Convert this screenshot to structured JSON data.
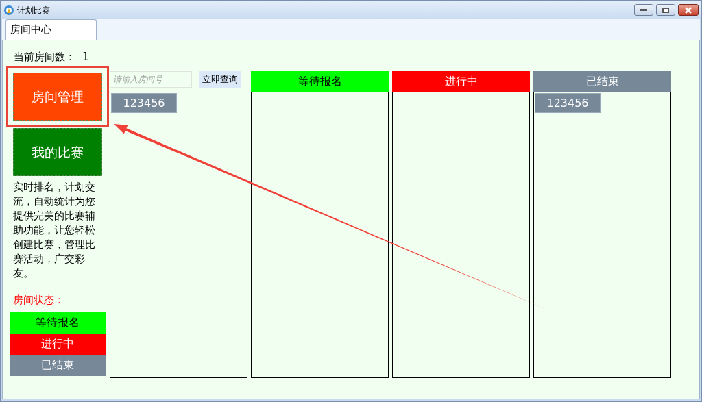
{
  "window": {
    "title": "计划比赛"
  },
  "tabs": [
    {
      "label": "房间中心",
      "selected": true
    }
  ],
  "room_count": {
    "label": "当前房间数：",
    "value": "1"
  },
  "nav_buttons": [
    {
      "label": "房间管理",
      "color": "#ff4500",
      "highlighted": true
    },
    {
      "label": "我的比赛",
      "color": "#008000",
      "highlighted": false
    }
  ],
  "description": "实时排名，计划交流，自动统计为您提供完美的比赛辅助功能，让您轻松创建比赛，管理比赛活动，广交彩友。",
  "legend": {
    "title": "房间状态：",
    "items": [
      {
        "label": "等待报名",
        "color": "#00ff00"
      },
      {
        "label": "进行中",
        "color": "#ff0000"
      },
      {
        "label": "已结束",
        "color": "#778899"
      }
    ]
  },
  "columns": [
    {
      "kind": "search",
      "placeholder": "请输入房间号",
      "button": "立即查询",
      "rooms": [
        "123456"
      ]
    },
    {
      "kind": "status",
      "label": "等待报名",
      "color": "#00ff00"
    },
    {
      "kind": "status",
      "label": "进行中",
      "color": "#ff0000"
    },
    {
      "kind": "status",
      "label": "已结束",
      "color": "#778899",
      "rooms": [
        "123456"
      ]
    }
  ],
  "annotation": {
    "arrow": true
  }
}
